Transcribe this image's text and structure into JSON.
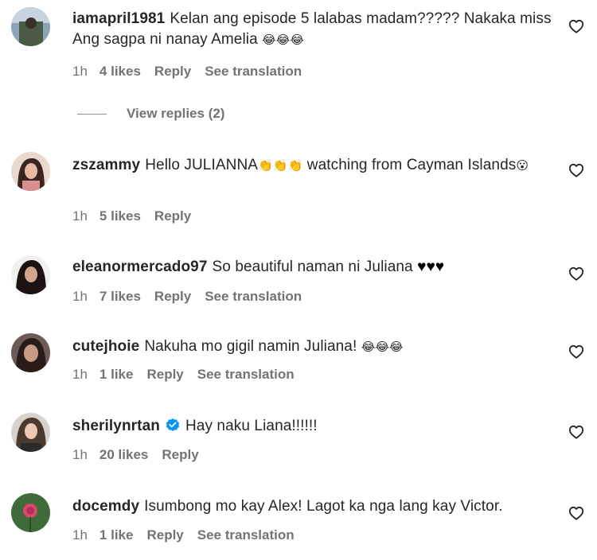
{
  "comments": [
    {
      "username": "iamapril1981",
      "text": "Kelan ang episode 5 lalabas madam????? Nakaka miss Ang sagpa ni nanay Amelia",
      "emoji": "😂😂😂",
      "time": "1h",
      "likes": "4 likes",
      "reply": "Reply",
      "translation": "See translation",
      "view_replies": "View replies (2)"
    },
    {
      "username": "zszammy",
      "text": "Hello JULIANNA",
      "emoji_mid": "👏👏👏",
      "text2": "watching from Cayman Islands",
      "emoji": "😮",
      "time": "1h",
      "likes": "5 likes",
      "reply": "Reply"
    },
    {
      "username": "eleanormercado97",
      "text": "So beautiful naman ni Juliana",
      "emoji": "♥♥♥",
      "time": "1h",
      "likes": "7 likes",
      "reply": "Reply",
      "translation": "See translation"
    },
    {
      "username": "cutejhoie",
      "text": "Nakuha mo gigil namin Juliana!",
      "emoji": "😂😂😂",
      "time": "1h",
      "likes": "1 like",
      "reply": "Reply",
      "translation": "See translation"
    },
    {
      "username": "sherilynrtan",
      "text": "Hay naku Liana!!!!!!",
      "time": "1h",
      "likes": "20 likes",
      "reply": "Reply"
    },
    {
      "username": "docemdy",
      "text": "Isumbong mo kay Alex! Lagot ka nga lang kay Victor.",
      "time": "1h",
      "likes": "1 like",
      "reply": "Reply",
      "translation": "See translation"
    }
  ],
  "colors": {
    "text": "#262626",
    "meta": "#737373",
    "verified": "#0095f6"
  },
  "icons": {
    "like": "heart-outline-icon",
    "verified": "verified-badge-icon"
  }
}
